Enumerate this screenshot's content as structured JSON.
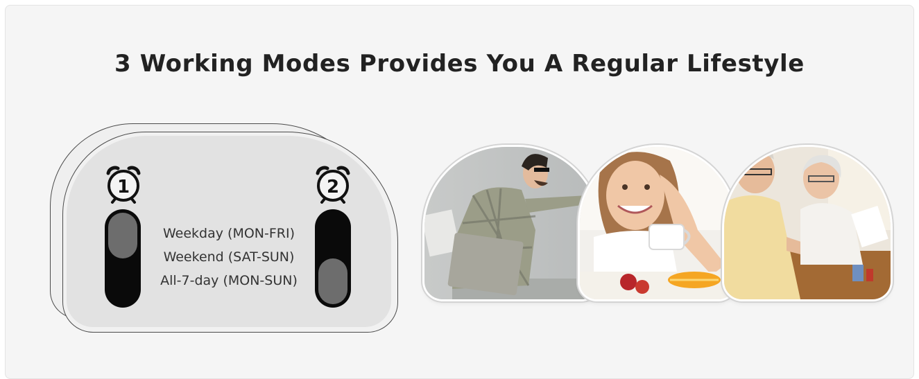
{
  "headline": "3 Working Modes Provides You A Regular Lifestyle",
  "device": {
    "switch_1_number": "1",
    "switch_2_number": "2",
    "modes": [
      "Weekday (MON-FRI)",
      "Weekend (SAT-SUN)",
      "All-7-day (MON-SUN)"
    ],
    "switch_1_position": "up",
    "switch_2_position": "down"
  },
  "photos": [
    {
      "subject": "young man with glasses leaning on wall holding laptop"
    },
    {
      "subject": "smiling young woman with coffee cup and fruit breakfast"
    },
    {
      "subject": "elderly couple sorting pills at table"
    }
  ],
  "colors": {
    "background": "#f5f5f5",
    "switch_body": "#0a0a0a",
    "switch_knob": "#6d6d6d",
    "device_face": "#e2e2e2"
  }
}
